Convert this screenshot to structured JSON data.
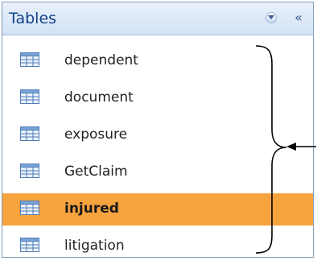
{
  "pane": {
    "title": "Tables",
    "dropdown_icon": "chevron-down-icon",
    "collapse_label": "«"
  },
  "items": [
    {
      "label": "dependent",
      "icon": "table-icon",
      "selected": false
    },
    {
      "label": "document",
      "icon": "table-icon",
      "selected": false
    },
    {
      "label": "exposure",
      "icon": "table-icon",
      "selected": false
    },
    {
      "label": "GetClaim",
      "icon": "table-icon",
      "selected": false
    },
    {
      "label": "injured",
      "icon": "table-icon",
      "selected": true
    },
    {
      "label": "litigation",
      "icon": "table-icon",
      "selected": false
    }
  ],
  "colors": {
    "header_text": "#15428b",
    "selection": "#f7a33e",
    "border": "#7f9db9"
  }
}
